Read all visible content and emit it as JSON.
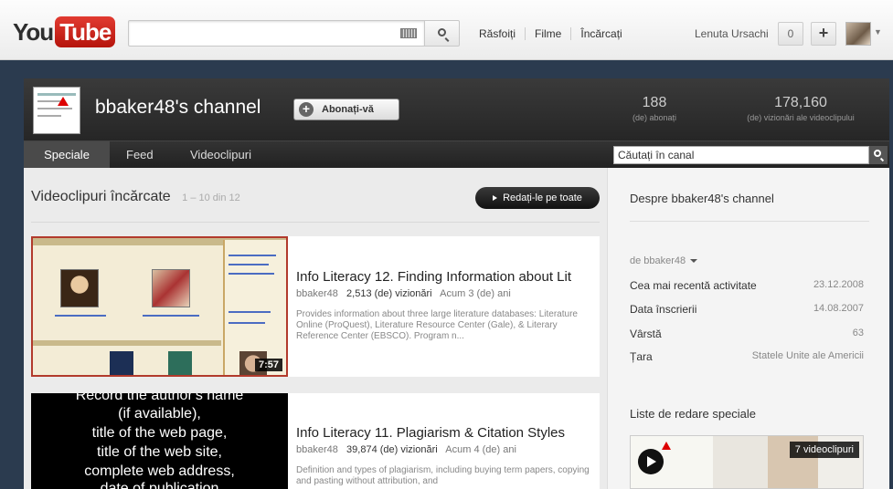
{
  "masthead": {
    "logo_you": "You",
    "logo_tube": "Tube",
    "search_value": "",
    "nav": [
      "Răsfoiți",
      "Filme",
      "Încărcați"
    ],
    "user_name": "Lenuta Ursachi",
    "notification_count": "0",
    "add_label": "+"
  },
  "channel": {
    "title": "bbaker48's channel",
    "subscribe_label": "Abonați-vă",
    "subscribers": "188",
    "subscribers_label": "(de) abonați",
    "views": "178,160",
    "views_label": "(de) vizionări ale videoclipului",
    "tabs": [
      "Speciale",
      "Feed",
      "Videoclipuri"
    ],
    "search_placeholder": "Căutați în canal"
  },
  "main": {
    "section_title": "Videoclipuri încărcate",
    "range": "1 – 10 din 12",
    "play_all_label": "Redați-le pe toate",
    "videos": [
      {
        "title": "Info Literacy 12. Finding Information about Lit",
        "author": "bbaker48",
        "views": "2,513 (de) vizionări",
        "age": "Acum 3 (de) ani",
        "description": "Provides information about three large literature databases: Literature Online (ProQuest), Literature Resource Center (Gale), & Literary Reference Center (EBSCO). Program n...",
        "duration": "7:57"
      },
      {
        "title": "Info Literacy 11. Plagiarism & Citation Styles",
        "author": "bbaker48",
        "views": "39,874 (de) vizionări",
        "age": "Acum 4 (de) ani",
        "description": "Definition and types of plagiarism, including buying term papers, copying and pasting without attribution, and",
        "thumb_lines": [
          "Record the author's name",
          "(if available),",
          "title of the web page,",
          "title of the web site,",
          "complete web address,",
          "date of publication"
        ]
      }
    ]
  },
  "sidebar": {
    "about_title": "Despre bbaker48's channel",
    "by_line": "de bbaker48",
    "rows": [
      {
        "label": "Cea mai recentă activitate",
        "value": "23.12.2008"
      },
      {
        "label": "Data înscrierii",
        "value": "14.08.2007"
      },
      {
        "label": "Vârstă",
        "value": "63"
      },
      {
        "label": "Țara",
        "value": "Statele Unite ale Americii"
      }
    ],
    "playlists_title": "Liste de redare speciale",
    "playlist_count": "7 videoclipuri"
  },
  "colors": {
    "brand_red": "#cc181e",
    "page_bg": "#2b3b4f",
    "header_dark": "#262626"
  }
}
